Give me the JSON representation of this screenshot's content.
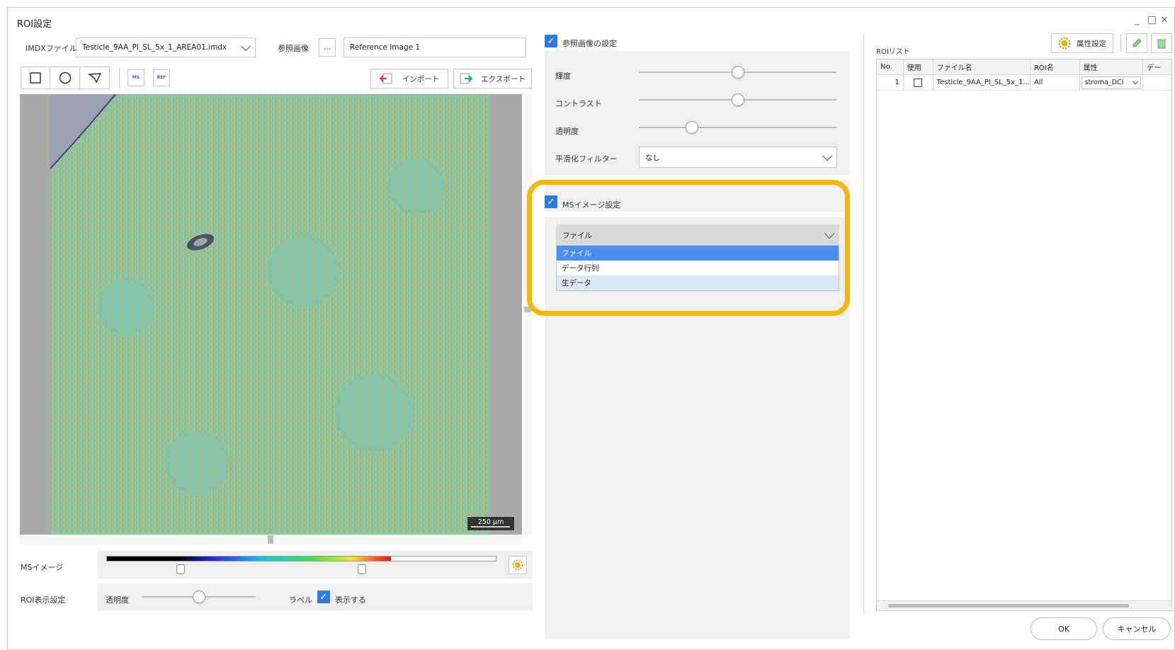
{
  "window": {
    "title": "ROI設定",
    "controls": [
      "_",
      "□",
      "×"
    ]
  },
  "toolbar": {
    "imdx_label": "IMDXファイル",
    "imdx_value": "Testicle_9AA_PI_SL_5x_1_AREA01.imdx",
    "ref_label": "参照画像",
    "ref_browse": "...",
    "ref_value": "Reference Image 1",
    "import_label": "インポート",
    "export_label": "エクスポート",
    "ms_icon_text": "MS",
    "ref_icon_text": "REF"
  },
  "image": {
    "scale_label": "250 μm"
  },
  "ms_image": {
    "label": "MSイメージ"
  },
  "roi_display": {
    "label": "ROI表示設定",
    "opacity_label": "透明度",
    "opacity_level": 0.5,
    "label_text": "ラベル",
    "show_label": "表示する"
  },
  "ref_settings": {
    "header": "参照画像の設定",
    "brightness_label": "輝度",
    "brightness_level": 0.5,
    "contrast_label": "コントラスト",
    "contrast_level": 0.5,
    "opacity_label": "透明度",
    "opacity_level": 0.27,
    "filter_label": "平滑化フィルター",
    "filter_value": "なし"
  },
  "ms_settings": {
    "header": "MSイメージ設定",
    "selected": "ファイル",
    "options": [
      "ファイル",
      "データ行列",
      "生データ"
    ]
  },
  "roi_list": {
    "title": "ROIリスト",
    "attr_button": "属性設定",
    "columns": [
      "No.",
      "使用",
      "ファイル名",
      "ROI名",
      "属性",
      "デー"
    ],
    "rows": [
      {
        "no": "1",
        "file": "Testicle_9AA_PI_SL_5x_1...",
        "roi": "All",
        "attr": "stroma_DCI"
      }
    ]
  },
  "footer": {
    "ok": "OK",
    "cancel": "キャンセル"
  },
  "colors": {
    "accent": "#2f7be5",
    "highlight": "#f7b700",
    "selected_option": "#4a8ef0"
  }
}
